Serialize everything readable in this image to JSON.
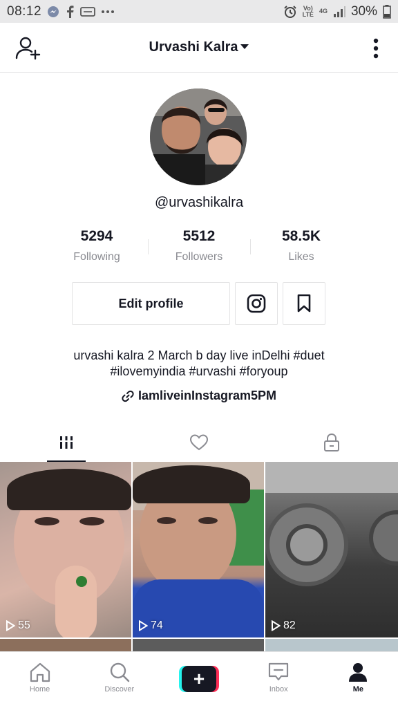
{
  "status_bar": {
    "time": "08:12",
    "network_top": "Vo)",
    "network_bottom": "LTE",
    "signal_gen": "4G",
    "battery": "30%"
  },
  "header": {
    "title": "Urvashi Kalra",
    "left_icon": "add-user-icon",
    "right_icon": "more-vertical-icon"
  },
  "profile": {
    "username": "@urvashikalra",
    "stats": [
      {
        "value": "5294",
        "label": "Following"
      },
      {
        "value": "5512",
        "label": "Followers"
      },
      {
        "value": "58.5K",
        "label": "Likes"
      }
    ],
    "edit_label": "Edit profile",
    "bio": "urvashi kalra  2 March  b day live inDelhi #duet\n#ilovemyindia #urvashi #foryoup",
    "link": "IamliveinInstagram5PM"
  },
  "tabs": [
    {
      "icon": "grid-icon",
      "active": true
    },
    {
      "icon": "heart-icon",
      "active": false
    },
    {
      "icon": "lock-icon",
      "active": false
    }
  ],
  "videos": [
    {
      "plays": "55"
    },
    {
      "plays": "74"
    },
    {
      "plays": "82"
    }
  ],
  "bottom_nav": [
    {
      "label": "Home"
    },
    {
      "label": "Discover"
    },
    {
      "label": ""
    },
    {
      "label": "Inbox"
    },
    {
      "label": "Me"
    }
  ],
  "colors": {
    "text": "#161823",
    "muted": "#8a8b91",
    "border": "#e3e3e4",
    "accent_red": "#fe2c55",
    "accent_cyan": "#25f4ee"
  }
}
